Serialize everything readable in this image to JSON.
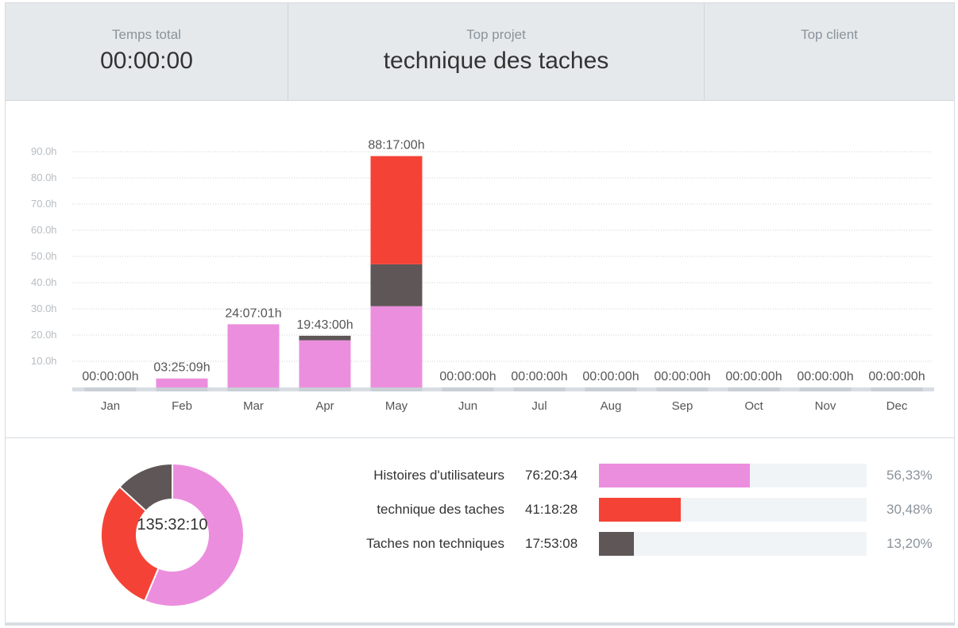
{
  "summary": {
    "total": {
      "label": "Temps total",
      "value": "00:00:00"
    },
    "project": {
      "label": "Top projet",
      "value": "technique des taches"
    },
    "client": {
      "label": "Top client",
      "value": ""
    }
  },
  "colors": {
    "pink": "#ec8ede",
    "red": "#f44336",
    "dark": "#5f5657",
    "track": "#f1f4f7",
    "baseline": "#d7dde2"
  },
  "chart_data": {
    "type": "bar",
    "stacked": true,
    "categories": [
      "Jan",
      "Feb",
      "Mar",
      "Apr",
      "May",
      "Jun",
      "Jul",
      "Aug",
      "Sep",
      "Oct",
      "Nov",
      "Dec"
    ],
    "y_ticks": [
      "10.0h",
      "20.0h",
      "30.0h",
      "40.0h",
      "50.0h",
      "60.0h",
      "70.0h",
      "80.0h",
      "90.0h"
    ],
    "ylim": [
      0,
      90
    ],
    "grid": true,
    "series": [
      {
        "name": "Histoires d'utilisateurs",
        "color": "#ec8ede",
        "values": [
          0,
          3.42,
          24.12,
          18.0,
          31.0,
          0,
          0,
          0,
          0,
          0,
          0,
          0
        ]
      },
      {
        "name": "Taches non techniques",
        "color": "#5f5657",
        "values": [
          0,
          0,
          0,
          1.72,
          16.0,
          0,
          0,
          0,
          0,
          0,
          0,
          0
        ]
      },
      {
        "name": "technique des taches",
        "color": "#f44336",
        "values": [
          0,
          0,
          0,
          0,
          41.3,
          0,
          0,
          0,
          0,
          0,
          0,
          0
        ]
      }
    ],
    "totals": [
      0,
      3.42,
      24.12,
      19.72,
      88.28,
      0,
      0,
      0,
      0,
      0,
      0,
      0
    ],
    "total_labels": [
      "00:00:00h",
      "03:25:09h",
      "24:07:01h",
      "19:43:00h",
      "88:17:00h",
      "00:00:00h",
      "00:00:00h",
      "00:00:00h",
      "00:00:00h",
      "00:00:00h",
      "00:00:00h",
      "00:00:00h"
    ]
  },
  "breakdown": {
    "total": "135:32:10",
    "items": [
      {
        "name": "Histoires d'utilisateurs",
        "time": "76:20:34",
        "percent_label": "56,33%",
        "percent": 56.33,
        "color": "#ec8ede"
      },
      {
        "name": "technique des taches",
        "time": "41:18:28",
        "percent_label": "30,48%",
        "percent": 30.48,
        "color": "#f44336"
      },
      {
        "name": "Taches non techniques",
        "time": "17:53:08",
        "percent_label": "13,20%",
        "percent": 13.2,
        "color": "#5f5657"
      }
    ]
  }
}
